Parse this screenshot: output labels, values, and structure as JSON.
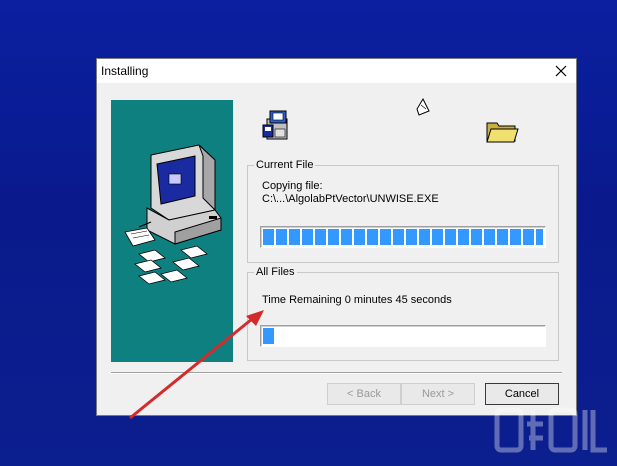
{
  "window": {
    "title": "Installing",
    "close_glyph": "✕"
  },
  "current_file": {
    "group_label": "Current File",
    "action_text": "Copying file:",
    "path_text": "C:\\...\\AlgolabPtVector\\UNWISE.EXE",
    "progress": 1.0
  },
  "all_files": {
    "group_label": "All Files",
    "time_remaining_text": "Time Remaining 0 minutes 45 seconds",
    "progress": 0.015
  },
  "buttons": {
    "back_label": "< Back",
    "next_label": "Next >",
    "cancel_label": "Cancel"
  },
  "colors": {
    "desktop_blue": "#0b1fa0",
    "banner_teal": "#0f8080",
    "progress_fill": "#3399ff",
    "arrow_red": "#d42a2a"
  },
  "icons": {
    "installer": "installer-package-icon",
    "flying_file": "flying-document-icon",
    "folder": "open-folder-icon",
    "computer": "computer-with-floppies-icon"
  }
}
